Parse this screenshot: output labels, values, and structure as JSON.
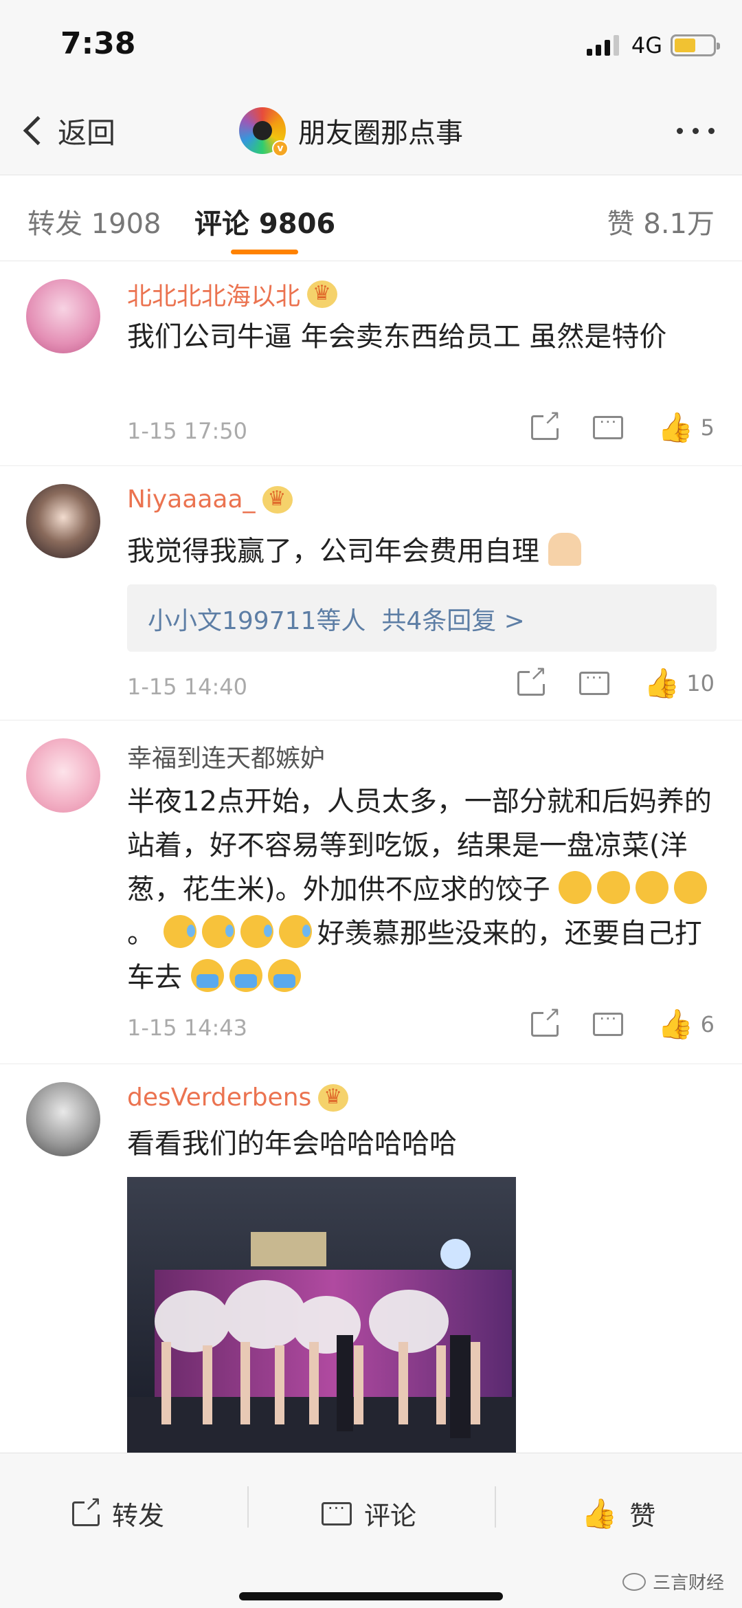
{
  "status_bar": {
    "time": "7:38",
    "network": "4G"
  },
  "nav": {
    "back_label": "返回",
    "title": "朋友圈那点事"
  },
  "tabs": {
    "repost": "转发 1908",
    "comment": "评论 9806",
    "like": "赞 8.1万"
  },
  "comments": [
    {
      "name": "北北北北海以北",
      "text": "我们公司牛逼  年会卖东西给员工  虽然是特价",
      "time": "1-15 17:50",
      "likes": "5"
    },
    {
      "name": "Niyaaaaa_",
      "text": "我觉得我赢了，公司年会费用自理",
      "reply_summary": "小小文199711等人",
      "reply_more": "共4条回复 >",
      "time": "1-15 14:40",
      "likes": "10"
    },
    {
      "name": "幸福到连天都嫉妒",
      "text_part1": "半夜12点开始，人员太多，一部分就和后妈养的站着，好不容易等到吃饭，结果是一盘凉菜(洋葱，花生米)。外加供不应求的饺子",
      "text_part2": "。",
      "text_part3": "好羡慕那些没来的，还要自己打车去",
      "time": "1-15 14:43",
      "likes": "6"
    },
    {
      "name": "desVerderbens",
      "text": "看看我们的年会哈哈哈哈哈"
    }
  ],
  "bottom_bar": {
    "repost": "转发",
    "comment": "评论",
    "like": "赞"
  },
  "watermark": "三言财经",
  "colors": {
    "accent": "#ff8200",
    "username": "#eb7350",
    "link": "#5d7ea5"
  }
}
